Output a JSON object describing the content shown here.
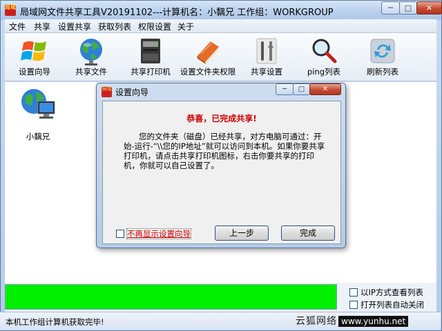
{
  "window": {
    "title": "局域网文件共享工具V20191102---计算机名：小黐兄  工作组：WORKGROUP",
    "app_icon_text": "局域",
    "min_glyph": "─",
    "max_glyph": "□",
    "close_glyph": "✕"
  },
  "menu": [
    "文件",
    "共享",
    "设置共享",
    "获取列表",
    "权限设置",
    "关于"
  ],
  "toolbar": [
    {
      "label": "设置向导",
      "icon": "windows-logo-icon"
    },
    {
      "label": "共享文件",
      "icon": "globe-icon"
    },
    {
      "label": "共享打印机",
      "icon": "printer-icon"
    },
    {
      "label": "设置文件夹权限",
      "icon": "book-icon"
    },
    {
      "label": "共享设置",
      "icon": "tools-icon"
    },
    {
      "label": "ping列表",
      "icon": "magnifier-icon"
    },
    {
      "label": "刷新列表",
      "icon": "refresh-icon"
    }
  ],
  "computers": [
    {
      "label": "小黐兄",
      "icon": "network-computer-icon"
    }
  ],
  "options": {
    "ip_view": "以IP方式查看列表",
    "auto_close": "打开列表自动关闭"
  },
  "status": "本机工作组计算机获取完毕!",
  "watermark": {
    "text": "云狐网络",
    "url": "www.yunhu.net"
  },
  "colors": {
    "progress": "#00f000",
    "dialog_heading": "#d00000"
  },
  "dialog": {
    "title": "设置向导",
    "icon_text": "局域",
    "heading": "恭喜，已完成共享!",
    "message": "您的文件夹（磁盘）已经共享，对方电脑可通过：开始-运行-“\\\\您的IP地址”就可以访问到本机。如果你要共享打印机，请点击共享打印机图标，右击你要共享的打印机，你就可以自己设置了。",
    "checkbox_label": "不再显示设置向导",
    "prev_button": "上一步",
    "finish_button": "完成"
  }
}
